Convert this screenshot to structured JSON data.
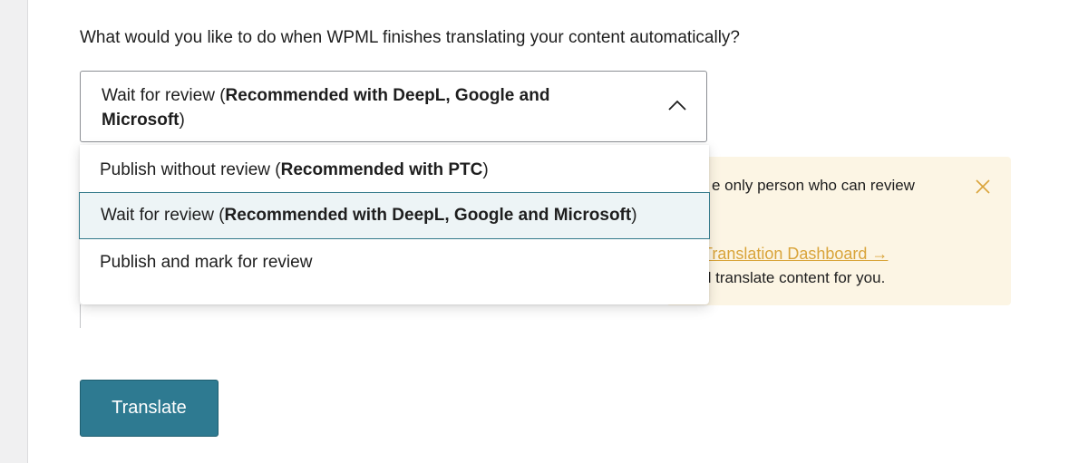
{
  "question": "What would you like to do when WPML finishes translating your content automatically?",
  "select": {
    "value_prefix": "Wait for review (",
    "value_bold": "Recommended with DeepL, Google and Microsoft",
    "value_suffix": ")",
    "chevron_icon": "chevron-up-icon"
  },
  "dropdown": {
    "options": [
      {
        "prefix": "Publish without review (",
        "bold": "Recommended with PTC",
        "suffix": ")"
      },
      {
        "prefix": "Wait for review (",
        "bold": "Recommended with DeepL, Google and Microsoft",
        "suffix": ")"
      },
      {
        "prefix": "Publish and mark for review",
        "bold": "",
        "suffix": ""
      }
    ],
    "selected_index": 1
  },
  "notice": {
    "line1": "e only person who can review",
    "link_text": "Translation Dashboard →",
    "line3": "d translate content for you.",
    "close_icon": "close-icon"
  },
  "translate_button": {
    "label": "Translate"
  },
  "colors": {
    "accent": "#2e7a91",
    "notice_bg": "#fcf5e4",
    "link": "#d9a43a",
    "option_selected_bg": "#edf4f6",
    "option_selected_border": "#33798a"
  }
}
